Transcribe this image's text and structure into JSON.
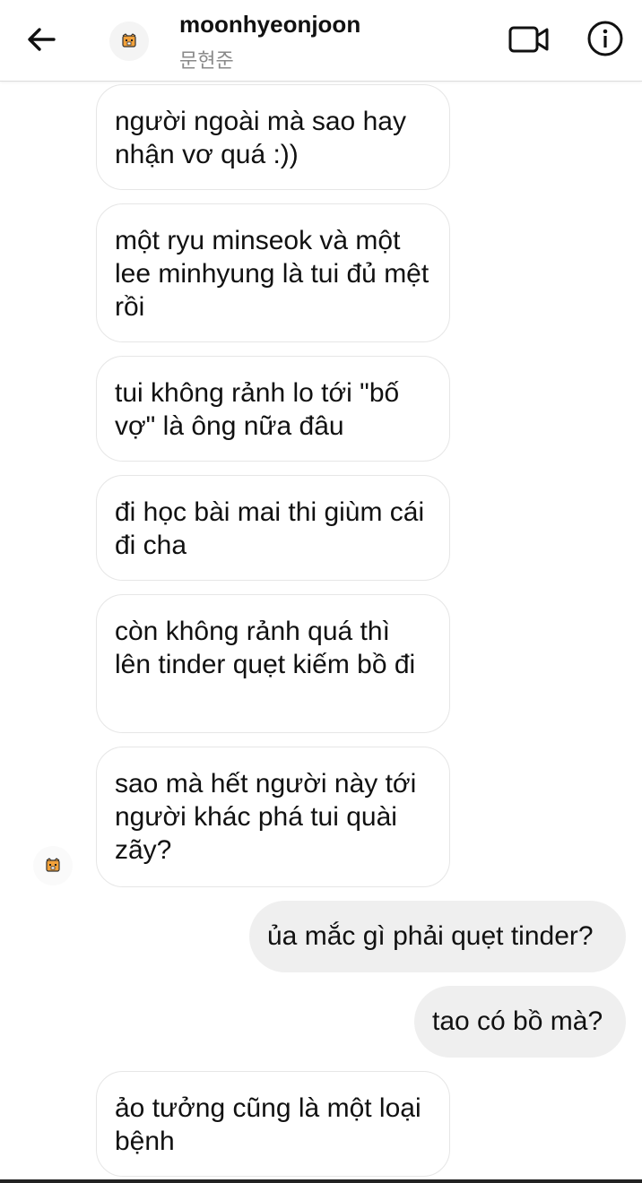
{
  "header": {
    "username": "moonhyeonjoon",
    "subname": "문현준",
    "back_icon": "arrow-left-icon",
    "video_icon": "video-camera-icon",
    "info_icon": "info-icon",
    "avatar_icon": "tiger-sticker-icon"
  },
  "messages": {
    "in1": "người ngoài mà sao hay nhận vơ quá :))",
    "in2": "một ryu minseok và một lee minhyung là tui đủ mệt rồi",
    "in3": "tui không rảnh lo tới \"bố vợ\" là ông nữa đâu",
    "in4": "đi học bài mai thi giùm cái đi cha",
    "in5": "còn không rảnh quá thì lên tinder quẹt kiếm bồ đi",
    "in6": "sao mà hết người này tới người khác phá tui quài zãy?",
    "out1": "ủa mắc gì phải quẹt tinder?",
    "out2": "tao có bồ mà?",
    "in7": "ảo tưởng cũng là một loại bệnh"
  },
  "colors": {
    "incoming_bg": "#ffffff",
    "incoming_border": "#e6e6e6",
    "outgoing_bg": "#efefef",
    "text": "#111111",
    "secondary_text": "#8a8a8a"
  }
}
